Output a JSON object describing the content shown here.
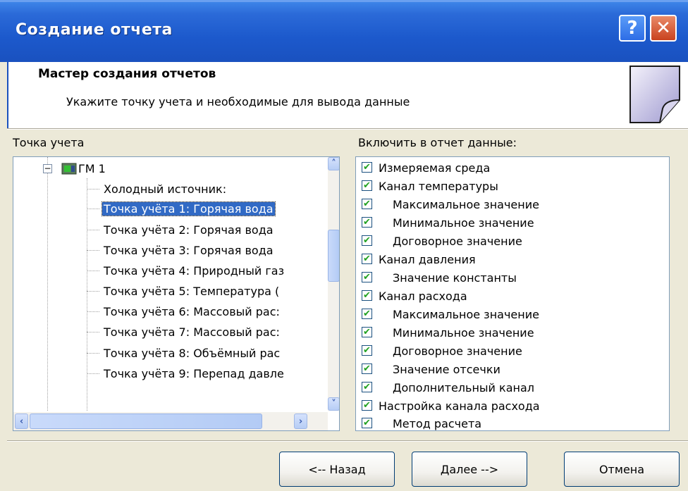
{
  "window": {
    "title": "Создание отчета",
    "help_glyph": "?",
    "close_glyph": "✕"
  },
  "header": {
    "title": "Мастер создания отчетов",
    "subtitle": "Укажите точку учета и необходимые для вывода данные"
  },
  "left_panel": {
    "label": "Точка учета",
    "tree": {
      "root": {
        "label": "ГМ 1",
        "expand_glyph": "−"
      },
      "items": [
        {
          "label": "Холодный источник:",
          "selected": false
        },
        {
          "label": "Точка учёта 1: Горячая вода",
          "selected": true
        },
        {
          "label": "Точка учёта 2: Горячая вода",
          "selected": false
        },
        {
          "label": "Точка учёта 3: Горячая вода",
          "selected": false
        },
        {
          "label": "Точка учёта 4: Природный газ",
          "selected": false
        },
        {
          "label": "Точка учёта 5: Температура  (",
          "selected": false
        },
        {
          "label": "Точка учёта 6: Массовый рас:",
          "selected": false
        },
        {
          "label": "Точка учёта 7: Массовый рас:",
          "selected": false
        },
        {
          "label": "Точка учёта 8: Объёмный рас",
          "selected": false
        },
        {
          "label": "Точка учёта 9: Перепад давле",
          "selected": false
        }
      ]
    }
  },
  "right_panel": {
    "label": "Включить в отчет данные:",
    "items": [
      {
        "label": "Измеряемая среда",
        "checked": true,
        "indent": 0
      },
      {
        "label": "Канал температуры",
        "checked": true,
        "indent": 0
      },
      {
        "label": "Максимальное значение",
        "checked": true,
        "indent": 1
      },
      {
        "label": "Минимальное значение",
        "checked": true,
        "indent": 1
      },
      {
        "label": "Договорное значение",
        "checked": true,
        "indent": 1
      },
      {
        "label": "Канал давления",
        "checked": true,
        "indent": 0
      },
      {
        "label": "Значение константы",
        "checked": true,
        "indent": 1
      },
      {
        "label": "Канал расхода",
        "checked": true,
        "indent": 0
      },
      {
        "label": "Максимальное значение",
        "checked": true,
        "indent": 1
      },
      {
        "label": "Минимальное значение",
        "checked": true,
        "indent": 1
      },
      {
        "label": "Договорное значение",
        "checked": true,
        "indent": 1
      },
      {
        "label": "Значение отсечки",
        "checked": true,
        "indent": 1
      },
      {
        "label": "Дополнительный канал",
        "checked": true,
        "indent": 1
      },
      {
        "label": "Настройка канала расхода",
        "checked": true,
        "indent": 0
      },
      {
        "label": "Метод расчета",
        "checked": true,
        "indent": 1
      }
    ]
  },
  "footer": {
    "back_label": "<-- Назад",
    "next_label": "Далее -->",
    "cancel_label": "Отмена"
  },
  "icons": {
    "help": "help-icon",
    "close": "close-icon",
    "document": "document-icon",
    "device": "device-icon",
    "collapse": "collapse-icon",
    "scroll_up": "chevron-up-icon",
    "scroll_down": "chevron-down-icon",
    "scroll_left": "chevron-left-icon",
    "scroll_right": "chevron-right-icon",
    "checkmark": "checkmark-icon"
  },
  "colors": {
    "titlebar": "#1c59cc",
    "selection": "#316ac5",
    "checkmark": "#21a121",
    "dialog_bg": "#ece9d8"
  }
}
